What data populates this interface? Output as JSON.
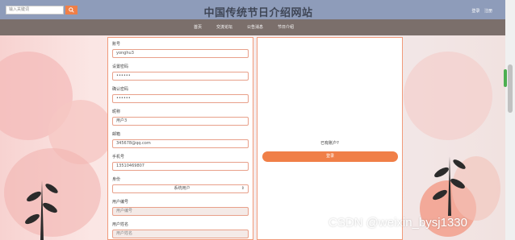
{
  "header": {
    "search_placeholder": "输入关键词",
    "search_icon": "search-icon",
    "title": "中国传统节日介绍网站",
    "login_link": "登录",
    "register_link": "注册"
  },
  "nav": {
    "items": [
      {
        "label": "首页"
      },
      {
        "label": "交流论坛"
      },
      {
        "label": "公告消息"
      },
      {
        "label": "节日介绍"
      }
    ]
  },
  "form": {
    "fields": [
      {
        "label": "账号",
        "value": "yonghu3"
      },
      {
        "label": "设置密码",
        "value": "••••••"
      },
      {
        "label": "确认密码",
        "value": "••••••"
      },
      {
        "label": "昵称",
        "value": "用户3"
      },
      {
        "label": "邮箱",
        "value": "345678@qq.com"
      },
      {
        "label": "手机号",
        "value": "13510469807"
      },
      {
        "label": "身份",
        "value": "系统用户"
      },
      {
        "label": "用户编号",
        "value": "用户编号"
      },
      {
        "label": "用户姓名",
        "value": "用户姓名"
      }
    ]
  },
  "side": {
    "has_account_text": "已有账户?",
    "login_button": "登录"
  },
  "watermark": "CSDN @weixin_bysj1330",
  "colors": {
    "topbar": "#8e9cba",
    "navbar": "#7b6f6b",
    "accent": "#f07f47",
    "panel_border": "#f19a7a"
  }
}
